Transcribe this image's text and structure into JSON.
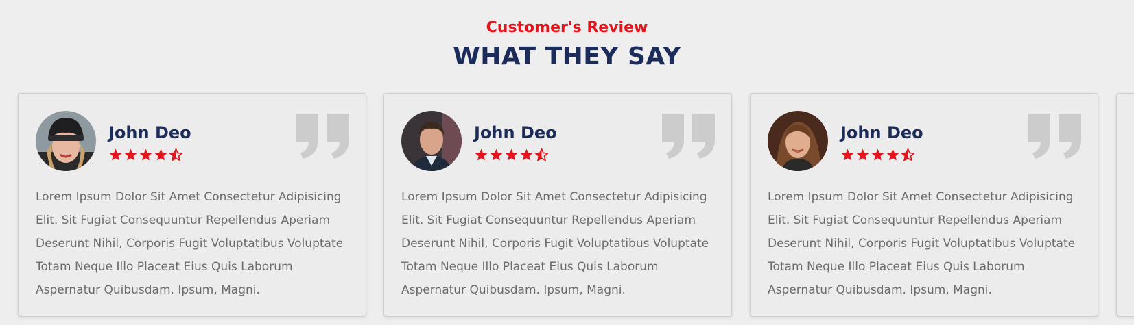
{
  "section": {
    "subtitle": "Customer's Review",
    "title": "WHAT THEY SAY"
  },
  "colors": {
    "accent": "#e3141b",
    "heading": "#1b2b5a",
    "body_text": "#6c6c6c",
    "quote": "#cccccc",
    "background": "#eeeeee"
  },
  "reviews": [
    {
      "name": "John Deo",
      "rating": 4.5,
      "avatar_icon": "avatar-woman-beanie",
      "text": "Lorem Ipsum Dolor Sit Amet Consectetur Adipisicing Elit. Sit Fugiat Consequuntur Repellendus Aperiam Deserunt Nihil, Corporis Fugit Voluptatibus Voluptate Totam Neque Illo Placeat Eius Quis Laborum Aspernatur Quibusdam. Ipsum, Magni."
    },
    {
      "name": "John Deo",
      "rating": 4.5,
      "avatar_icon": "avatar-man",
      "text": "Lorem Ipsum Dolor Sit Amet Consectetur Adipisicing Elit. Sit Fugiat Consequuntur Repellendus Aperiam Deserunt Nihil, Corporis Fugit Voluptatibus Voluptate Totam Neque Illo Placeat Eius Quis Laborum Aspernatur Quibusdam. Ipsum, Magni."
    },
    {
      "name": "John Deo",
      "rating": 4.5,
      "avatar_icon": "avatar-woman-curly",
      "text": "Lorem Ipsum Dolor Sit Amet Consectetur Adipisicing Elit. Sit Fugiat Consequuntur Repellendus Aperiam Deserunt Nihil, Corporis Fugit Voluptatibus Voluptate Totam Neque Illo Placeat Eius Quis Laborum Aspernatur Quibusdam. Ipsum, Magni."
    }
  ]
}
